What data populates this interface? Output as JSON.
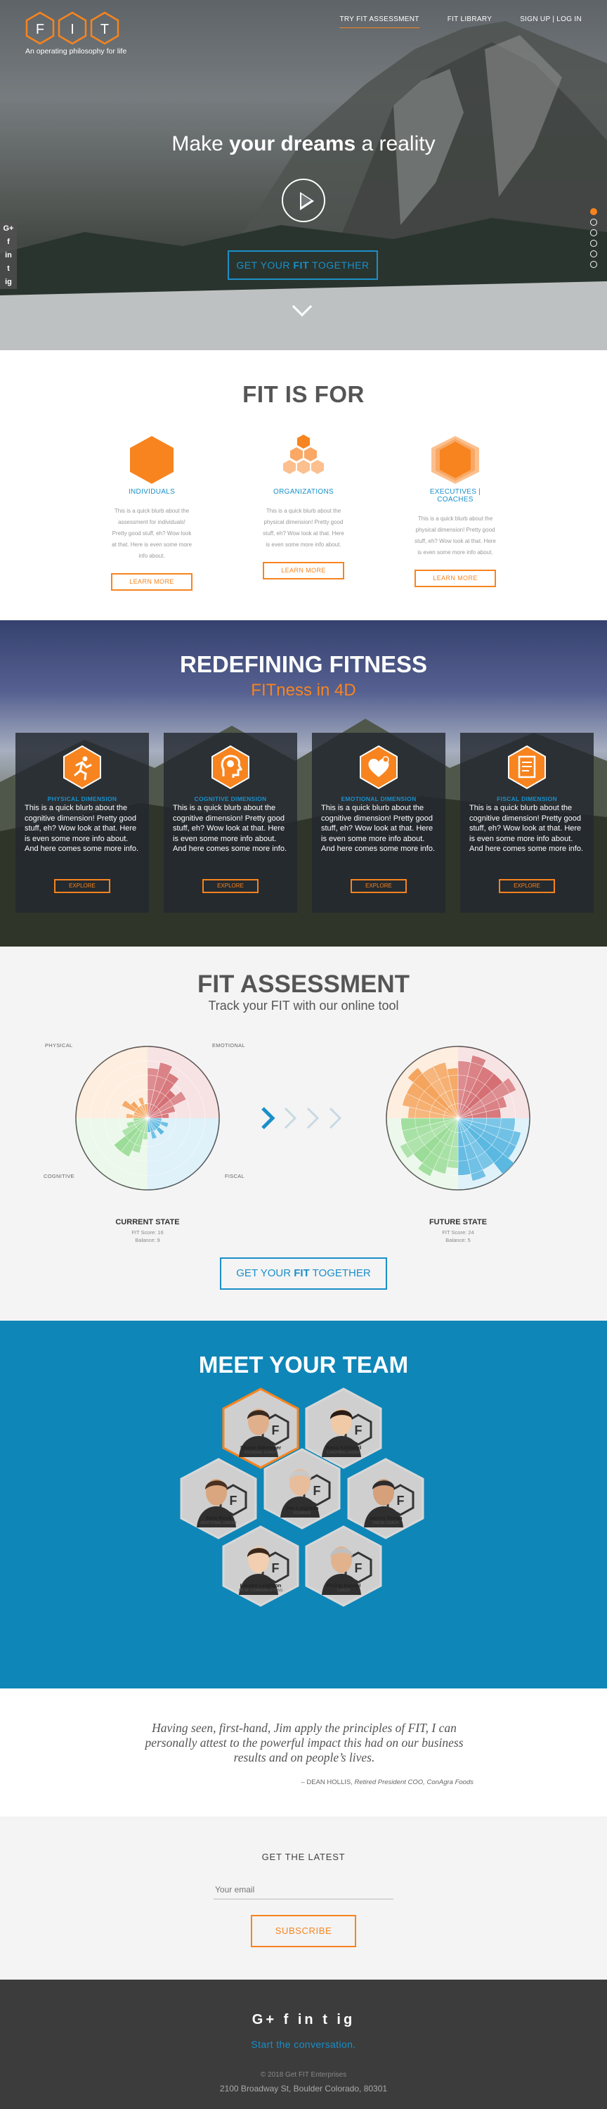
{
  "header": {
    "logo_letters": [
      "F",
      "I",
      "T"
    ],
    "tagline": "An operating philosophy for life",
    "nav": [
      {
        "label": "TRY FIT ASSESSMENT",
        "active": true
      },
      {
        "label": "FIT LIBRARY",
        "active": false
      },
      {
        "label": "SIGN UP | LOG IN",
        "active": false
      }
    ]
  },
  "hero": {
    "headline_pre": "Make",
    "headline_bold": "your dreams",
    "headline_post": "a reality",
    "cta_pre": "GET YOUR",
    "cta_bold": "FIT",
    "cta_post": "TOGETHER",
    "social_icons": [
      "G+",
      "f",
      "in",
      "t",
      "ig"
    ],
    "slide_count": 6,
    "active_slide": 1
  },
  "fit_is_for": {
    "title": "FIT IS FOR",
    "items": [
      {
        "label": "INDIVIDUALS",
        "text": "This is a quick blurb about the assessment for individuals! Pretty good stuff, eh? Wow look at that. Here is even some more info about.",
        "button": "LEARN MORE",
        "icon": "single-hexagon-icon"
      },
      {
        "label": "ORGANIZATIONS",
        "text": "This is a quick blurb about the physical dimension! Pretty good stuff, eh? Wow look at that. Here is even some more info about.",
        "button": "LEARN MORE",
        "icon": "hexagon-cluster-icon"
      },
      {
        "label": "EXECUTIVES | COACHES",
        "text": "This is a quick blurb about the physical dimension! Pretty good stuff, eh? Wow look at that. Here is even some more info about.",
        "button": "LEARN MORE",
        "icon": "stacked-hexagon-icon"
      }
    ]
  },
  "redefining": {
    "title": "REDEFINING FITNESS",
    "subtitle": "FITness in 4D",
    "cards": [
      {
        "label": "PHYSICAL DIMENSION",
        "text": "This is a quick blurb about the cognitive dimension! Pretty good stuff, eh? Wow look at that. Here is even some more info about. And here comes some more info.",
        "button": "EXPLORE",
        "icon": "runner-icon"
      },
      {
        "label": "COGNITIVE DIMENSION",
        "text": "This is a quick blurb about the cognitive dimension! Pretty good stuff, eh? Wow look at that. Here is even some more info about. And here comes some more info.",
        "button": "EXPLORE",
        "icon": "brain-head-icon"
      },
      {
        "label": "EMOTIONAL DIMENSION",
        "text": "This is a quick blurb about the cognitive dimension! Pretty good stuff, eh? Wow look at that. Here is even some more info about. And here comes some more info.",
        "button": "EXPLORE",
        "icon": "heart-icon"
      },
      {
        "label": "FISCAL DIMENSION",
        "text": "This is a quick blurb about the cognitive dimension! Pretty good stuff, eh? Wow look at that. Here is even some more info about. And here comes some more info.",
        "button": "EXPLORE",
        "icon": "ledger-icon"
      }
    ]
  },
  "assessment": {
    "title": "FIT ASSESSMENT",
    "subtitle": "Track your FIT with our online tool",
    "quadrant_labels": {
      "physical": "PHYSICAL",
      "emotional": "EMOTIONAL",
      "cognitive": "COGNITIVE",
      "fiscal": "FISCAL"
    },
    "current": {
      "title": "CURRENT STATE",
      "score": "FIT Score: 16",
      "balance": "Balance: 9"
    },
    "future": {
      "title": "FUTURE STATE",
      "score": "FIT Score: 24",
      "balance": "Balance: 5"
    },
    "cta_pre": "GET YOUR",
    "cta_bold": "FIT",
    "cta_post": "TOGETHER",
    "colors": {
      "physical": "#c8464b",
      "emotional": "#2ba3d9",
      "cognitive": "#f28a2e",
      "fiscal": "#7ed37a"
    },
    "chart_data": [
      {
        "type": "polar-area",
        "title": "CURRENT STATE",
        "max": 5,
        "series": [
          {
            "name": "PHYSICAL",
            "values": [
              3.5,
              4,
              3.5,
              2.5,
              3,
              2,
              1.5
            ]
          },
          {
            "name": "EMOTIONAL",
            "values": [
              1,
              1.5,
              1,
              1.5,
              1,
              1.5,
              1
            ]
          },
          {
            "name": "FISCAL",
            "values": [
              1.5,
              2.5,
              3,
              3,
              2,
              1.5,
              1
            ]
          },
          {
            "name": "COGNITIVE",
            "values": [
              1.5,
              1,
              2,
              1.5,
              1,
              1.5,
              1
            ]
          }
        ]
      },
      {
        "type": "polar-area",
        "title": "FUTURE STATE",
        "max": 5,
        "series": [
          {
            "name": "PHYSICAL",
            "values": [
              4,
              4.5,
              4,
              4,
              4.5,
              3.5,
              3
            ]
          },
          {
            "name": "EMOTIONAL",
            "values": [
              4,
              4.5,
              4.5,
              5,
              4,
              4.5,
              4
            ]
          },
          {
            "name": "FISCAL",
            "values": [
              3.5,
              4,
              4.5,
              4,
              4.5,
              4,
              4
            ]
          },
          {
            "name": "COGNITIVE",
            "values": [
              3.5,
              4,
              4,
              4.5,
              4,
              4,
              3.5
            ]
          }
        ]
      }
    ]
  },
  "team": {
    "title": "MEET YOUR TEAM",
    "members": [
      {
        "name": "Shane Niemeyer",
        "role": "FOUNDER, COACH",
        "highlight": true
      },
      {
        "name": "Rena Kirkland",
        "role": "COACHING LEADER",
        "highlight": false
      },
      {
        "name": "Sara Rusk",
        "role": "ADDITIONAL LEADER",
        "highlight": false
      },
      {
        "name": "Jim Leighton",
        "role": "FOUNDER",
        "highlight": false
      },
      {
        "name": "James Doran",
        "role": "FISCAL COACH",
        "highlight": false
      },
      {
        "name": "Lauren Leighton",
        "role": "VP OF COMMUNICATIONS",
        "highlight": false
      },
      {
        "name": "Phillip Kassel",
        "role": "COACH",
        "highlight": false
      }
    ]
  },
  "testimonial": {
    "quote": "Having seen, first-hand, Jim apply the principles of FIT, I can personally attest to the powerful impact this had on our business results and on people’s lives.",
    "author": "– DEAN HOLLIS,",
    "author_title": "Retired President COO, ConAgra Foods"
  },
  "newsletter": {
    "title": "GET THE LATEST",
    "placeholder": "Your email",
    "button": "SUBSCRIBE"
  },
  "footer": {
    "icons": [
      "G+",
      "f",
      "in",
      "t",
      "ig"
    ],
    "tagline": "Start the conversation.",
    "copyright": "© 2018 Get FIT Enterprises",
    "address": "2100 Broadway St, Boulder Colorado, 80301"
  }
}
